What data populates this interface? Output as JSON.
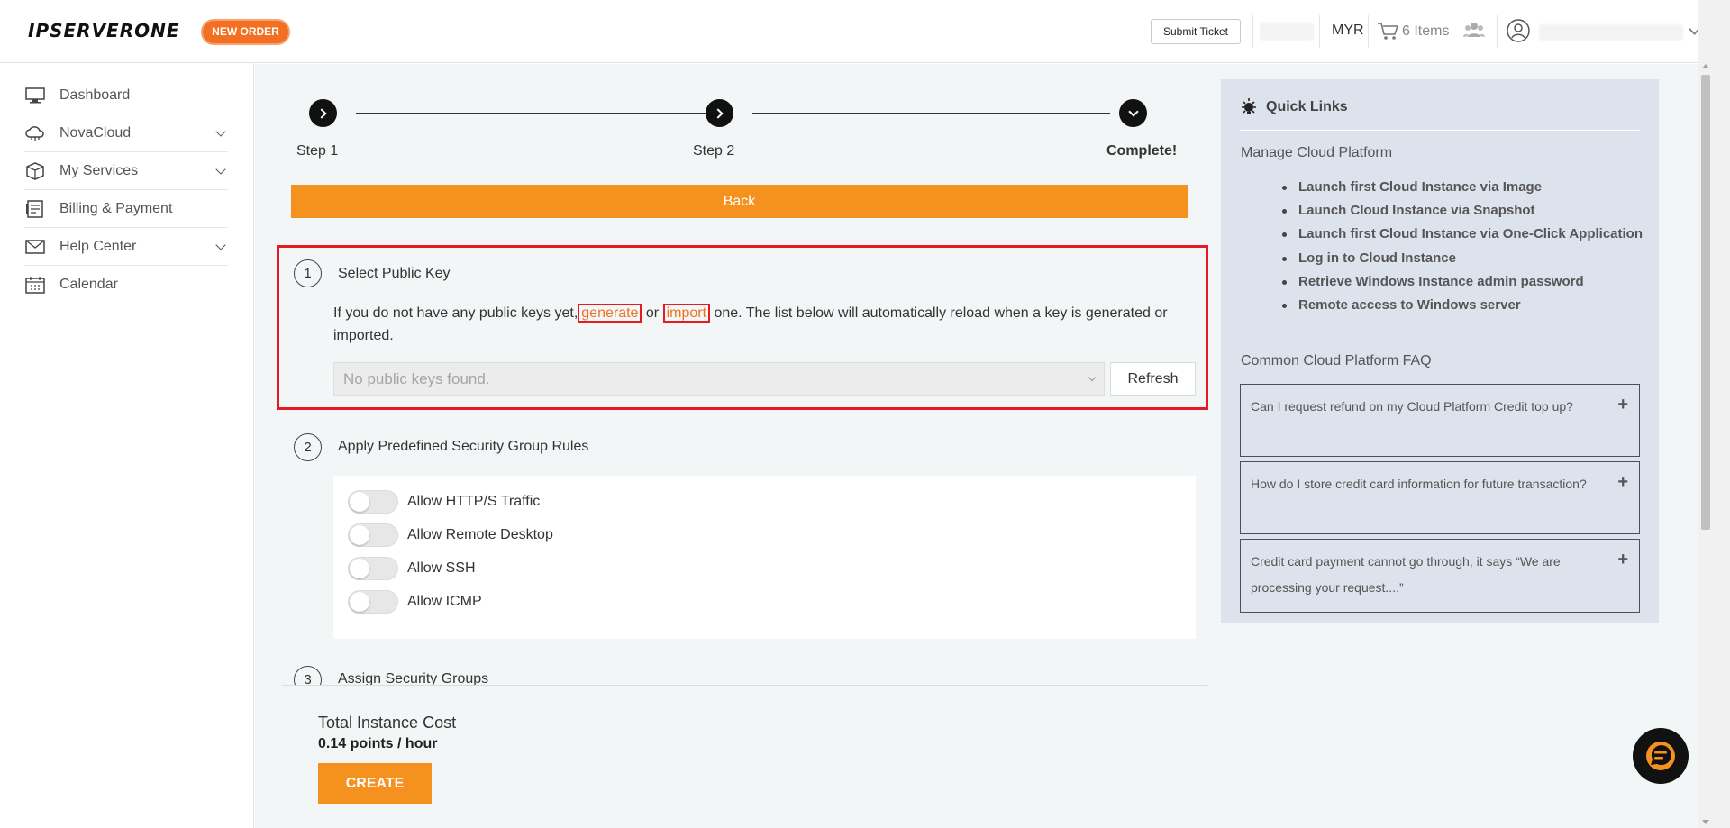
{
  "header": {
    "logo_text": "IPSERVERONE",
    "new_order_label": "NEW ORDER",
    "submit_ticket_label": "Submit Ticket",
    "currency": "MYR",
    "cart_label": "6 Items"
  },
  "sidebar": {
    "items": [
      {
        "label": "Dashboard",
        "icon": "monitor-icon"
      },
      {
        "label": "NovaCloud",
        "icon": "cloud-icon"
      },
      {
        "label": "My Services",
        "icon": "box-icon"
      },
      {
        "label": "Billing & Payment",
        "icon": "billing-icon"
      },
      {
        "label": "Help Center",
        "icon": "mail-icon"
      },
      {
        "label": "Calendar",
        "icon": "calendar-icon"
      }
    ]
  },
  "stepper": {
    "steps": [
      "Step 1",
      "Step 2",
      "Complete!"
    ]
  },
  "back_label": "Back",
  "sections": [
    {
      "number": "1",
      "title": "Select Public Key"
    },
    {
      "number": "2",
      "title": "Apply Predefined Security Group Rules"
    },
    {
      "number": "3",
      "title": "Assign Security Groups"
    }
  ],
  "public_key": {
    "desc_before": "If you do not have any public keys yet,",
    "generate_link": "generate",
    "desc_or": " or ",
    "import_link": "import",
    "desc_after": " one. The list below will automatically reload when a key is generated or imported.",
    "select_placeholder": "No public keys found.",
    "refresh_label": "Refresh"
  },
  "security_rules": [
    "Allow HTTP/S Traffic",
    "Allow Remote Desktop",
    "Allow SSH",
    "Allow ICMP"
  ],
  "footer": {
    "cost_label": "Total Instance Cost",
    "cost_value": "0.14 points / hour",
    "create_label": "CREATE"
  },
  "quick_links": {
    "title": "Quick Links",
    "manage_title": "Manage Cloud Platform",
    "links": [
      "Launch first Cloud Instance via Image",
      "Launch Cloud Instance via Snapshot",
      "Launch first Cloud Instance via One-Click Application",
      "Log in to Cloud Instance",
      "Retrieve Windows Instance admin password",
      "Remote access to Windows server"
    ],
    "faq_title": "Common Cloud Platform FAQ",
    "faqs": [
      "Can I request refund on my Cloud Platform Credit top up?",
      "How do I store credit card information for future transaction?",
      "Credit card payment cannot go through, it says “We are processing your request....”"
    ]
  },
  "colors": {
    "accent_orange": "#f5911e",
    "highlight_red": "#e51b23",
    "panel_blue": "#dde3ec"
  }
}
